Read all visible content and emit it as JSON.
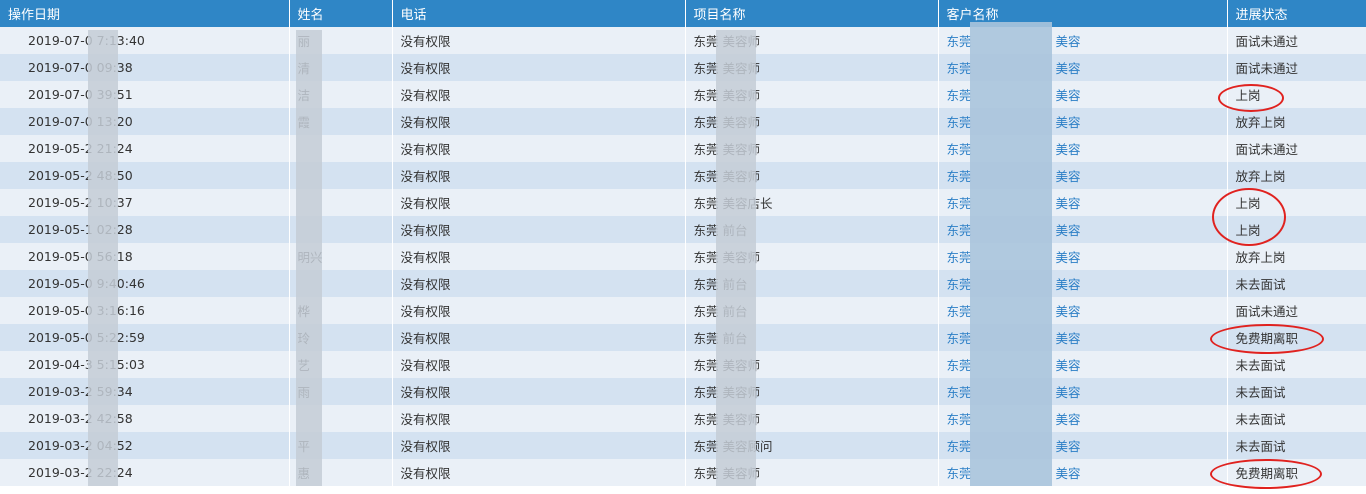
{
  "columns": [
    "操作日期",
    "姓名",
    "电话",
    "项目名称",
    "客户名称",
    "进展状态"
  ],
  "rows": [
    {
      "date": "2019-07-0 7:13:40",
      "name": "丽",
      "phone": "没有权限",
      "project": "东莞 美容师",
      "client_a": "东莞",
      "client_b": "美容",
      "status": "面试未通过"
    },
    {
      "date": "2019-07-0 09:38",
      "name": "清",
      "phone": "没有权限",
      "project": "东莞 美容师",
      "client_a": "东莞",
      "client_b": "美容",
      "status": "面试未通过"
    },
    {
      "date": "2019-07-0 39:51",
      "name": "洁",
      "phone": "没有权限",
      "project": "东莞 美容师",
      "client_a": "东莞",
      "client_b": "美容",
      "status": "上岗"
    },
    {
      "date": "2019-07-0 13:20",
      "name": "霞",
      "phone": "没有权限",
      "project": "东莞 美容师",
      "client_a": "东莞",
      "client_b": "美容",
      "status": "放弃上岗"
    },
    {
      "date": "2019-05-2 21:24",
      "name": "",
      "phone": "没有权限",
      "project": "东莞 美容师",
      "client_a": "东莞",
      "client_b": "美容",
      "status": "面试未通过"
    },
    {
      "date": "2019-05-2 48:50",
      "name": "",
      "phone": "没有权限",
      "project": "东莞 美容师",
      "client_a": "东莞",
      "client_b": "美容",
      "status": "放弃上岗"
    },
    {
      "date": "2019-05-2 10:37",
      "name": "",
      "phone": "没有权限",
      "project": "东莞 美容店长",
      "client_a": "东莞",
      "client_b": "美容",
      "status": "上岗"
    },
    {
      "date": "2019-05-1 02:28",
      "name": "",
      "phone": "没有权限",
      "project": "东莞 前台",
      "client_a": "东莞",
      "client_b": "美容",
      "status": "上岗"
    },
    {
      "date": "2019-05-0 56:18",
      "name": "明兴",
      "phone": "没有权限",
      "project": "东莞 美容师",
      "client_a": "东莞",
      "client_b": "美容",
      "status": "放弃上岗"
    },
    {
      "date": "2019-05-0 9:40:46",
      "name": "",
      "phone": "没有权限",
      "project": "东莞 前台",
      "client_a": "东莞",
      "client_b": "美容",
      "status": "未去面试"
    },
    {
      "date": "2019-05-0 3:16:16",
      "name": "桦",
      "phone": "没有权限",
      "project": "东莞 前台",
      "client_a": "东莞",
      "client_b": "美容",
      "status": "面试未通过"
    },
    {
      "date": "2019-05-0 5:22:59",
      "name": "玲",
      "phone": "没有权限",
      "project": "东莞 前台",
      "client_a": "东莞",
      "client_b": "美容",
      "status": "免费期离职"
    },
    {
      "date": "2019-04-3 5:15:03",
      "name": "艺",
      "phone": "没有权限",
      "project": "东莞 美容师",
      "client_a": "东莞",
      "client_b": "美容",
      "status": "未去面试"
    },
    {
      "date": "2019-03-2 59:34",
      "name": "雨",
      "phone": "没有权限",
      "project": "东莞 美容师",
      "client_a": "东莞",
      "client_b": "美容",
      "status": "未去面试"
    },
    {
      "date": "2019-03-2 42:58",
      "name": "",
      "phone": "没有权限",
      "project": "东莞 美容师",
      "client_a": "东莞",
      "client_b": "美容",
      "status": "未去面试"
    },
    {
      "date": "2019-03-2 04:52",
      "name": "平",
      "phone": "没有权限",
      "project": "东莞 美容顾问",
      "client_a": "东莞",
      "client_b": "美容",
      "status": "未去面试"
    },
    {
      "date": "2019-03-2 22:24",
      "name": "惠",
      "phone": "没有权限",
      "project": "东莞 美容师",
      "client_a": "东莞",
      "client_b": "美容",
      "status": "免费期离职"
    }
  ],
  "colors": {
    "header": "#2f86c6",
    "row_odd": "#eaf0f7",
    "row_even": "#d4e2f1",
    "link": "#2c7fc6",
    "annotation": "#e0221f"
  }
}
